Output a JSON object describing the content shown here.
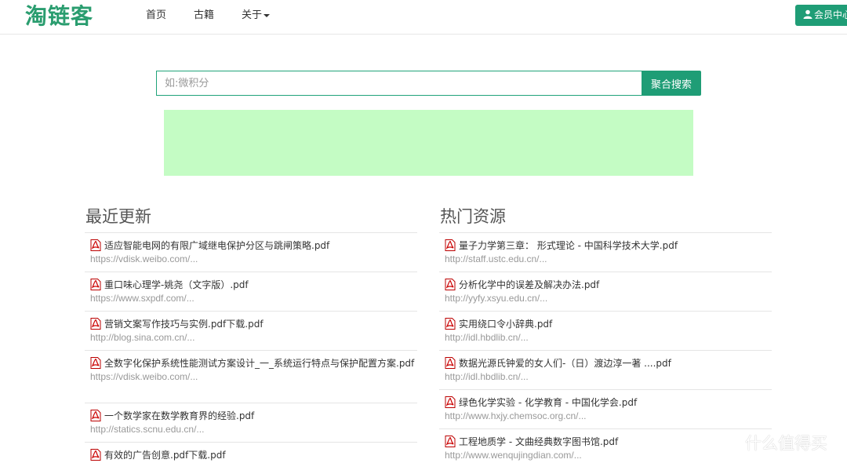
{
  "header": {
    "logo_text": "淘链客",
    "nav": {
      "home": "首页",
      "books": "古籍",
      "about": "关于"
    },
    "member_button": "会员中心"
  },
  "search": {
    "placeholder": "如:微积分",
    "button_label": "聚合搜索"
  },
  "recent": {
    "title": "最近更新",
    "items": [
      {
        "title": "适应智能电网的有限广域继电保护分区与跳闸策略.pdf",
        "url": "https://vdisk.weibo.com/..."
      },
      {
        "title": "重口味心理学-姚尧（文字版）.pdf",
        "url": "https://www.sxpdf.com/..."
      },
      {
        "title": "营销文案写作技巧与实例.pdf下载.pdf",
        "url": "http://blog.sina.com.cn/..."
      },
      {
        "title": "全数字化保护系统性能测试方案设计_一_系统运行特点与保护配置方案.pdf",
        "url": "https://vdisk.weibo.com/..."
      },
      {
        "title": "一个数学家在数学教育界的经验.pdf",
        "url": "http://statics.scnu.edu.cn/..."
      },
      {
        "title": "有效的广告创意.pdf下载.pdf",
        "url": ""
      }
    ]
  },
  "hot": {
    "title": "热门资源",
    "items": [
      {
        "title": "量子力学第三章： 形式理论 - 中国科学技术大学.pdf",
        "url": "http://staff.ustc.edu.cn/..."
      },
      {
        "title": "分析化学中的误差及解决办法.pdf",
        "url": "http://yyfy.xsyu.edu.cn/..."
      },
      {
        "title": "实用绕口令小辞典.pdf",
        "url": "http://idl.hbdlib.cn/..."
      },
      {
        "title": "数据光源氏钟爱的女人们-（日）渡边淳一著 ....pdf",
        "url": "http://idl.hbdlib.cn/..."
      },
      {
        "title": "绿色化学实验 - 化学教育 - 中国化学会.pdf",
        "url": "http://www.hxjy.chemsoc.org.cn/..."
      },
      {
        "title": "工程地质学 - 文曲经典数字图书馆.pdf",
        "url": "http://www.wenqujingdian.com/..."
      }
    ]
  },
  "watermark": {
    "logo_char": "值",
    "text": "什么值得买"
  },
  "colors": {
    "brand_green": "#1f9d76",
    "ad_banner": "#c4fcc4"
  }
}
